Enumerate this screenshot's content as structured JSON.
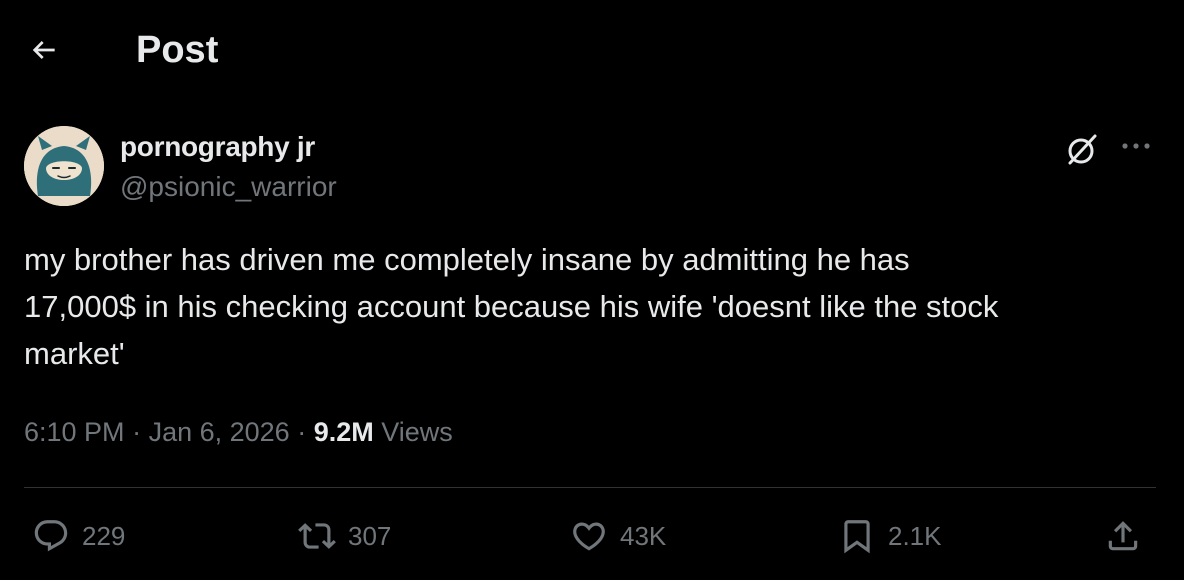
{
  "header": {
    "title": "Post"
  },
  "author": {
    "name": "pornography jr",
    "handle": "@psionic_warrior"
  },
  "post": {
    "text": "my brother has driven me completely insane by admitting he has\n17,000$ in his checking account because his wife 'doesnt like the stock\nmarket'",
    "time": "6:10 PM",
    "date": "Jan 6, 2026",
    "separator": " · ",
    "views_count": "9.2M",
    "views_label": " Views"
  },
  "actions": {
    "replies": "229",
    "reposts": "307",
    "likes": "43K",
    "bookmarks": "2.1K"
  },
  "colors": {
    "background": "#000000",
    "text_primary": "#e7e9ea",
    "text_secondary": "#71767b",
    "divider": "#2f3336"
  },
  "icons": {
    "back": "arrow-left-icon",
    "grok": "grok-icon",
    "more": "more-horizontal-icon",
    "reply": "reply-icon",
    "repost": "repost-icon",
    "like": "heart-icon",
    "bookmark": "bookmark-icon",
    "share": "share-icon"
  }
}
